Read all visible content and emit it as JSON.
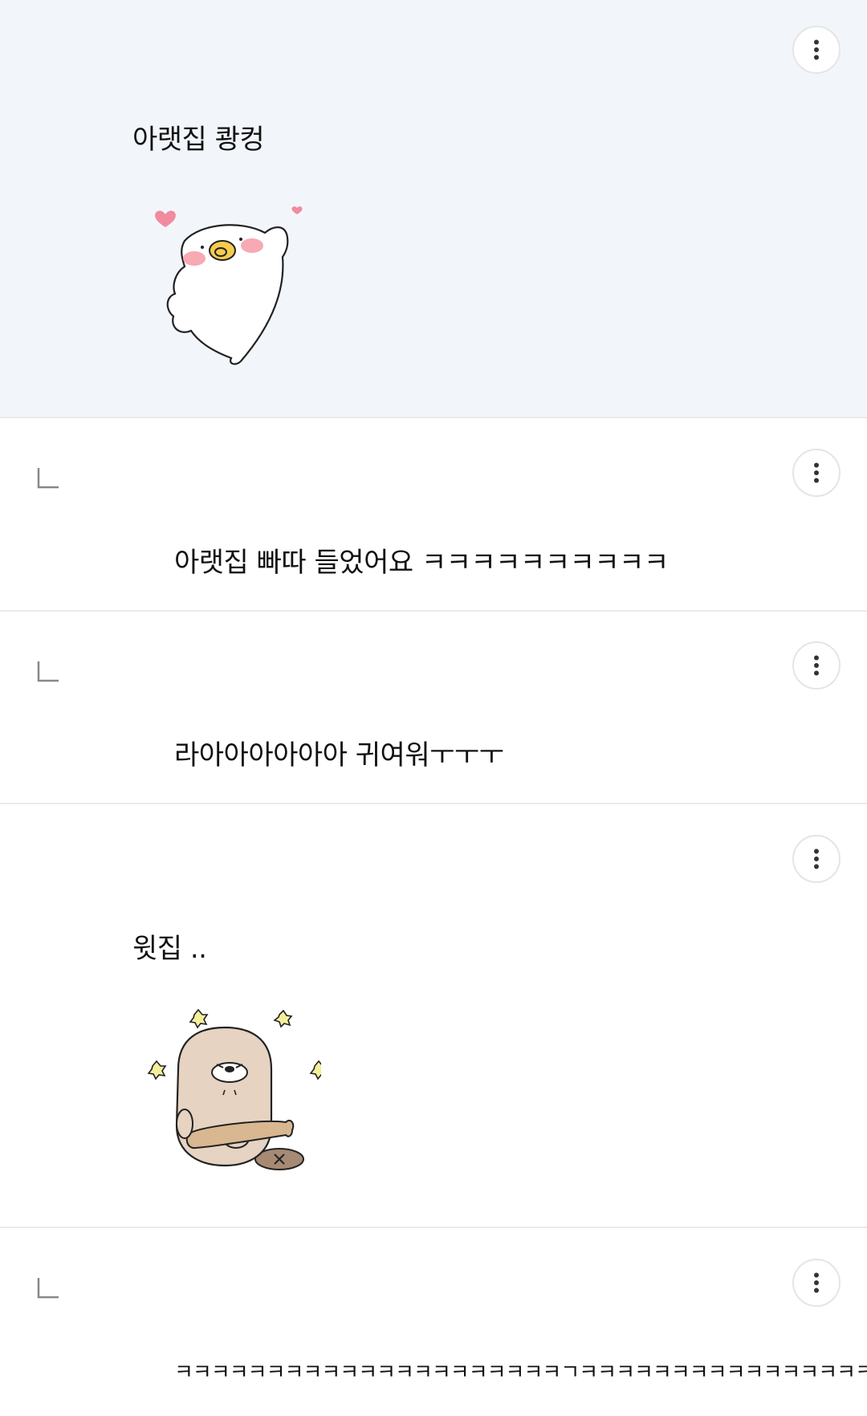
{
  "comments": [
    {
      "type": "comment",
      "text": "아랫집 쾅컹",
      "sticker": "white-seal-waving-with-hearts-sticker"
    },
    {
      "type": "reply",
      "text": "아랫집 빠따 들었어요 ㅋㅋㅋㅋㅋㅋㅋㅋㅋㅋ"
    },
    {
      "type": "reply",
      "text": "라아아아아아아 귀여워ㅜㅜㅜ"
    },
    {
      "type": "comment",
      "text": "윗집 ..",
      "sticker": "beaver-holding-bat-sticker"
    },
    {
      "type": "reply",
      "text": "ㅋㅋㅋㅋㅋㅋㅋㅋㅋㅋㅋㅋㅋㅋㅋㅋㅋㅋㅋㅋㅋㄱㅋㅋㅋㅋㅋㅋㅋㅋㅋㅋㅋㅋㅋㅋㅋㅋㅋㅋ"
    }
  ],
  "icons": {
    "more": "more-vertical-icon",
    "reply": "reply-arrow-icon"
  },
  "colors": {
    "highlight_bg": "#f2f6fb",
    "divider": "#e9eaec",
    "heart": "#f08ba0",
    "cheek": "#f7a9b4",
    "beaver_body": "#e6d3c2",
    "bat": "#d8b791"
  }
}
